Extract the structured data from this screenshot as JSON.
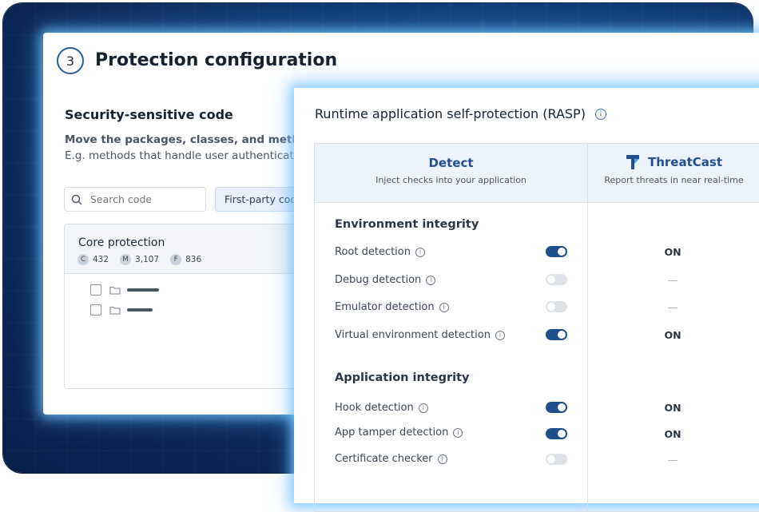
{
  "page": {
    "step_number": "3",
    "title": "Protection configuration"
  },
  "security_code": {
    "title": "Security-sensitive code",
    "description_bold": "Move the packages, classes, and method",
    "description": "E.g. methods that handle user authenticatio",
    "search_placeholder": "Search code",
    "filter_label": "First-party code"
  },
  "tree": {
    "title": "Core protection",
    "stats": [
      {
        "badge": "C",
        "value": "432"
      },
      {
        "badge": "M",
        "value": "3,107"
      },
      {
        "badge": "F",
        "value": "836"
      }
    ],
    "rows": [
      {
        "checked": false,
        "icon": "folder-icon"
      },
      {
        "checked": false,
        "icon": "folder-icon"
      }
    ]
  },
  "rasp": {
    "title": "Runtime application self-protection (RASP)",
    "detect_header": "Detect",
    "detect_sub": "Inject checks into your application",
    "threatcast_header": "ThreatCast",
    "threatcast_sub": "Report threats in near real-time",
    "groups": [
      {
        "title": "Environment integrity",
        "items": [
          {
            "label": "Root detection",
            "enabled": true,
            "threatcast": "ON"
          },
          {
            "label": "Debug detection",
            "enabled": false,
            "threatcast": "—"
          },
          {
            "label": "Emulator detection",
            "enabled": false,
            "threatcast": "—"
          },
          {
            "label": "Virtual environment detection",
            "enabled": true,
            "threatcast": "ON"
          }
        ]
      },
      {
        "title": "Application integrity",
        "items": [
          {
            "label": "Hook detection",
            "enabled": true,
            "threatcast": "ON"
          },
          {
            "label": "App tamper detection",
            "enabled": true,
            "threatcast": "ON"
          },
          {
            "label": "Certificate checker",
            "enabled": false,
            "threatcast": "—"
          }
        ]
      }
    ]
  },
  "colors": {
    "accent": "#1f4e8c",
    "background_glow": "#78c8ff",
    "toggle_off": "#dde2e8"
  }
}
